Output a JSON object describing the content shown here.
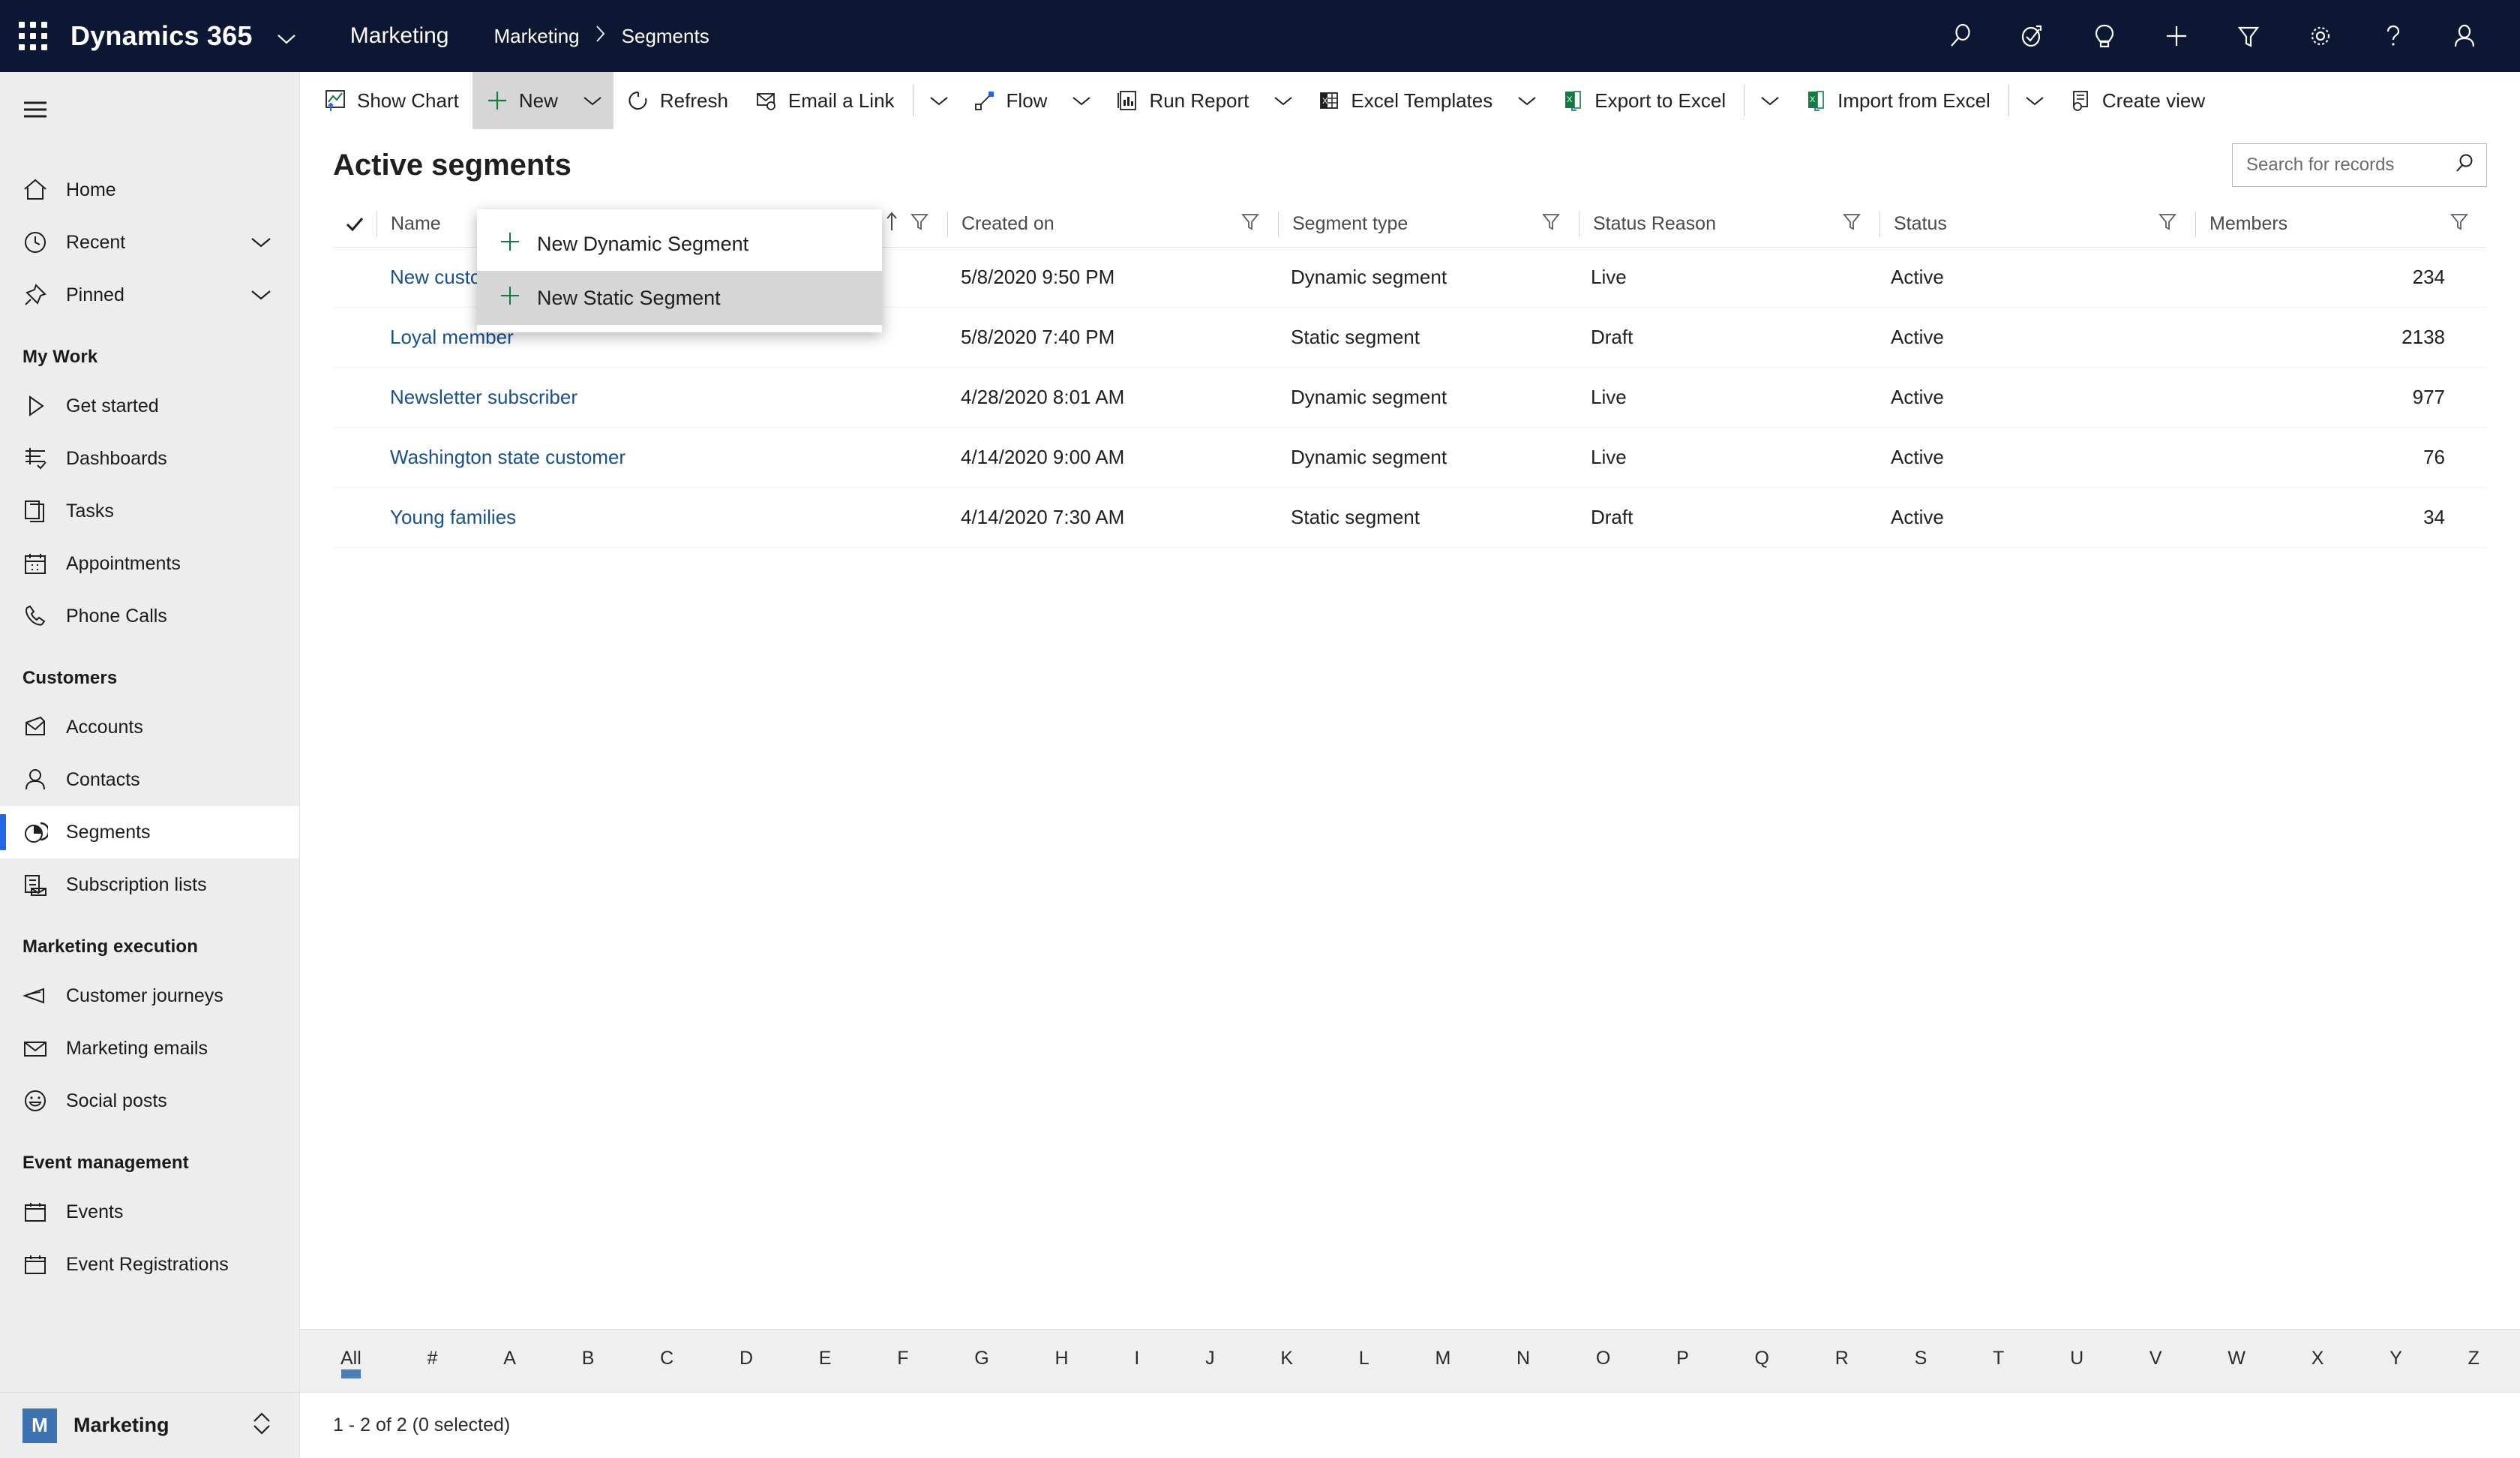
{
  "topnav": {
    "waffle_label": "app-launcher",
    "brand": "Dynamics 365",
    "app_name": "Marketing",
    "breadcrumb": [
      "Marketing",
      "Segments"
    ],
    "breadcrumb_separator": "›",
    "icons": [
      {
        "name": "search-icon",
        "title": "Search"
      },
      {
        "name": "relationship-assistant-icon",
        "title": "Assistant"
      },
      {
        "name": "lightbulb-icon",
        "title": "Insights"
      },
      {
        "name": "quick-create-icon",
        "title": "Quick create"
      },
      {
        "name": "filter-icon",
        "title": "Filter"
      },
      {
        "name": "gear-icon",
        "title": "Settings"
      },
      {
        "name": "help-icon",
        "title": "Help"
      },
      {
        "name": "account-icon",
        "title": "Account"
      }
    ]
  },
  "sidebar": {
    "hamburger": "site-map-toggle",
    "top_items": [
      {
        "label": "Home",
        "icon": "home-icon",
        "chevron": false,
        "active": false
      },
      {
        "label": "Recent",
        "icon": "clock-icon",
        "chevron": true,
        "active": false
      },
      {
        "label": "Pinned",
        "icon": "pin-icon",
        "chevron": true,
        "active": false
      }
    ],
    "groups": [
      {
        "title": "My Work",
        "items": [
          {
            "label": "Get started",
            "icon": "play-icon",
            "active": false
          },
          {
            "label": "Dashboards",
            "icon": "dashboard-icon",
            "active": false
          },
          {
            "label": "Tasks",
            "icon": "tasks-icon",
            "active": false
          },
          {
            "label": "Appointments",
            "icon": "calendar-icon",
            "active": false
          },
          {
            "label": "Phone Calls",
            "icon": "phone-icon",
            "active": false
          }
        ]
      },
      {
        "title": "Customers",
        "items": [
          {
            "label": "Accounts",
            "icon": "accounts-icon",
            "active": false
          },
          {
            "label": "Contacts",
            "icon": "contact-icon",
            "active": false
          },
          {
            "label": "Segments",
            "icon": "segments-pie-icon",
            "active": true
          },
          {
            "label": "Subscription lists",
            "icon": "subscription-list-icon",
            "active": false
          }
        ]
      },
      {
        "title": "Marketing execution",
        "items": [
          {
            "label": "Customer journeys",
            "icon": "megaphone-icon",
            "active": false
          },
          {
            "label": "Marketing emails",
            "icon": "envelope-icon",
            "active": false
          },
          {
            "label": "Social posts",
            "icon": "smiley-icon",
            "active": false
          }
        ]
      },
      {
        "title": "Event management",
        "items": [
          {
            "label": "Events",
            "icon": "calendar-blank-icon",
            "active": false
          },
          {
            "label": "Event Registrations",
            "icon": "calendar-blank-icon",
            "active": false
          }
        ]
      }
    ],
    "footer": {
      "tile": "M",
      "label": "Marketing",
      "switcher_icon": "up-down-chevron-icon"
    }
  },
  "commandbar": [
    {
      "label": "Show Chart",
      "icon": "show-chart-icon",
      "caret": false,
      "highlight": false
    },
    {
      "label": "New",
      "icon": "plus-icon",
      "caret": true,
      "highlight": true
    },
    {
      "label": "Refresh",
      "icon": "refresh-icon",
      "caret": false,
      "highlight": false
    },
    {
      "label": "Email a Link",
      "icon": "email-link-icon",
      "caret": true,
      "highlight": false
    },
    {
      "label": "Flow",
      "icon": "flow-icon",
      "caret": true,
      "highlight": false
    },
    {
      "label": "Run Report",
      "icon": "run-report-icon",
      "caret": true,
      "highlight": false
    },
    {
      "label": "Excel Templates",
      "icon": "excel-template-icon",
      "caret": true,
      "highlight": false
    },
    {
      "label": "Export to Excel",
      "icon": "excel-export-icon",
      "caret": true,
      "highlight": false
    },
    {
      "label": "Import from Excel",
      "icon": "excel-import-icon",
      "caret": true,
      "highlight": false
    },
    {
      "label": "Create view",
      "icon": "create-view-icon",
      "caret": false,
      "highlight": false
    }
  ],
  "new_menu": {
    "open": true,
    "items": [
      {
        "label": "New Dynamic Segment",
        "icon": "plus-icon",
        "hovered": false
      },
      {
        "label": "New Static Segment",
        "icon": "plus-icon",
        "hovered": true
      }
    ]
  },
  "page": {
    "title": "Active segments",
    "search_placeholder": "Search for records",
    "search_value": "",
    "search_icon": "search-icon"
  },
  "grid": {
    "select_all_icon": "checkmark-icon",
    "columns": [
      {
        "label": "Name",
        "sorted": "asc",
        "sort_icon": "arrow-up-icon",
        "filter_icon": "filter-icon"
      },
      {
        "label": "Created on",
        "sorted": "",
        "filter_icon": "filter-icon"
      },
      {
        "label": "Segment type",
        "sorted": "",
        "filter_icon": "filter-icon"
      },
      {
        "label": "Status Reason",
        "sorted": "",
        "filter_icon": "filter-icon"
      },
      {
        "label": "Status",
        "sorted": "",
        "filter_icon": "filter-icon"
      },
      {
        "label": "Members",
        "sorted": "",
        "filter_icon": "filter-icon"
      }
    ],
    "rows": [
      {
        "name": "New customer",
        "created_on": "5/8/2020 9:50 PM",
        "segment_type": "Dynamic segment",
        "status_reason": "Live",
        "status": "Active",
        "members": "234"
      },
      {
        "name": "Loyal member",
        "created_on": "5/8/2020 7:40 PM",
        "segment_type": "Static segment",
        "status_reason": "Draft",
        "status": "Active",
        "members": "2138"
      },
      {
        "name": "Newsletter subscriber",
        "created_on": "4/28/2020 8:01 AM",
        "segment_type": "Dynamic segment",
        "status_reason": "Live",
        "status": "Active",
        "members": "977"
      },
      {
        "name": "Washington state customer",
        "created_on": "4/14/2020 9:00 AM",
        "segment_type": "Dynamic segment",
        "status_reason": "Live",
        "status": "Active",
        "members": "76"
      },
      {
        "name": "Young families",
        "created_on": "4/14/2020 7:30 AM",
        "segment_type": "Static segment",
        "status_reason": "Draft",
        "status": "Active",
        "members": "34"
      }
    ]
  },
  "alpha_bar": {
    "selected": "All",
    "items": [
      "All",
      "#",
      "A",
      "B",
      "C",
      "D",
      "E",
      "F",
      "G",
      "H",
      "I",
      "J",
      "K",
      "L",
      "M",
      "N",
      "O",
      "P",
      "Q",
      "R",
      "S",
      "T",
      "U",
      "V",
      "W",
      "X",
      "Y",
      "Z"
    ]
  },
  "footer": {
    "status": "1 - 2 of 2 (0 selected)"
  },
  "colors": {
    "nav_bg": "#0b1733",
    "sidebar_bg": "#ededed",
    "accent_blue": "#2266e3",
    "link_blue": "#15508f",
    "excel_green": "#107c41",
    "tile_blue": "#3d73b0",
    "highlight_gray": "#d6d6d6"
  }
}
